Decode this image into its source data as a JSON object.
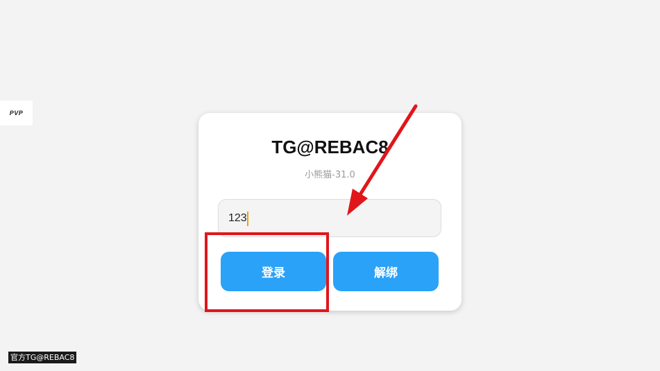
{
  "side_badge": {
    "label": "PVP"
  },
  "login_card": {
    "title": "TG@REBAC8",
    "subtitle": "小熊猫-31.0",
    "key_input": {
      "value": "123",
      "placeholder": ""
    },
    "login_label": "登录",
    "unbind_label": "解绑"
  },
  "footer": {
    "label": "官方TG@REBAC8"
  },
  "colors": {
    "background": "#f3f3f3",
    "button": "#2aa2f8",
    "annotation_red": "#e0161b",
    "caret": "#f0a000"
  }
}
